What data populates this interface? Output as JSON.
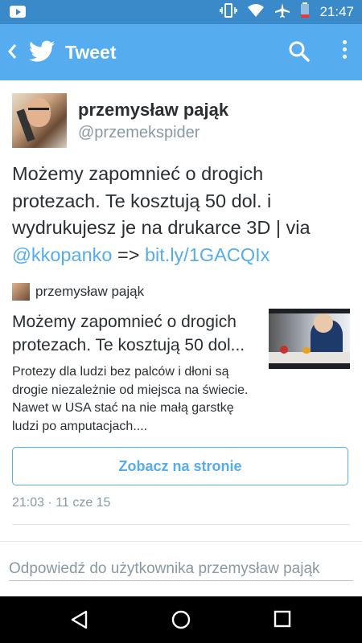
{
  "status_bar": {
    "time": "21:47",
    "icons": [
      "youtube-notification-icon",
      "vibrate-icon",
      "wifi-icon",
      "airplane-mode-icon",
      "battery-low-icon"
    ],
    "colors": {
      "background": "#3a89c9"
    }
  },
  "app_bar": {
    "title": "Tweet",
    "icons": [
      "back-icon",
      "twitter-bird-icon",
      "search-icon",
      "overflow-menu-icon"
    ],
    "colors": {
      "background": "#55acee"
    }
  },
  "tweet": {
    "author_name": "przemysław pająk",
    "author_handle": "@przemekspider",
    "text": "Możemy zapomnieć o drogich protezach. Te kosztują 50 dol. i wydrukujesz je na drukarce 3D | via ",
    "mention": "@kkopanko",
    "arrow": " => ",
    "link": "bit.ly/1GACQIx",
    "timestamp": "21:03 · 11 cze 15"
  },
  "card": {
    "author_name": "przemysław pająk",
    "title": "Możemy zapomnieć o drogich protezach. Te kosztują 50 dol...",
    "description": "Protezy dla ludzi bez palców i dłoni są drogie niezależnie od miejsca na świecie. Nawet w USA stać na nie małą garstkę ludzi po amputacjach....",
    "button_label": "Zobacz na stronie"
  },
  "reply": {
    "placeholder": "Odpowiedź do użytkownika przemysław pająk",
    "value": ""
  },
  "nav_bar": {
    "icons": [
      "back-triangle-icon",
      "home-circle-icon",
      "recents-square-icon"
    ]
  },
  "colors": {
    "accent": "#55acee",
    "text": "#292f33",
    "secondary_text": "#8899a6",
    "divider": "#e1e8ed"
  }
}
